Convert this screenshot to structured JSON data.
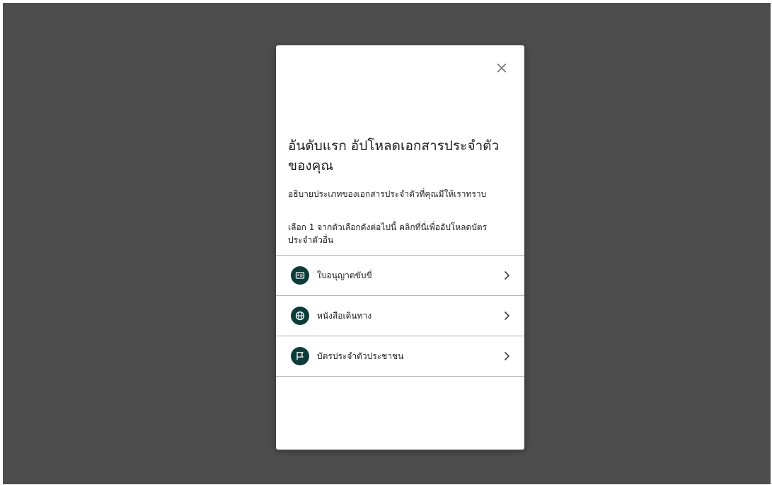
{
  "dialog": {
    "title": "อันดับแรก อัปโหลดเอกสารประจำตัวของคุณ",
    "description": "อธิบายประเภทของเอกสารประจำตัวที่คุณมีให้เราทราบ",
    "instruction": "เลือก 1 จากตัวเลือกดังต่อไปนี้ คลิกที่นี่เพื่ออัปโหลดบัตรประจำตัวอื่น",
    "close_icon": "close-icon",
    "options": [
      {
        "label": "ใบอนุญาตขับขี่",
        "icon": "id-card-icon"
      },
      {
        "label": "หนังสือเดินทาง",
        "icon": "globe-icon"
      },
      {
        "label": "บัตรประจำตัวประชาชน",
        "icon": "flag-icon"
      }
    ]
  },
  "colors": {
    "backdrop": "#4d4d4d",
    "icon_circle": "#0d3b3a",
    "text": "#202124",
    "divider": "#b5b5b5"
  }
}
